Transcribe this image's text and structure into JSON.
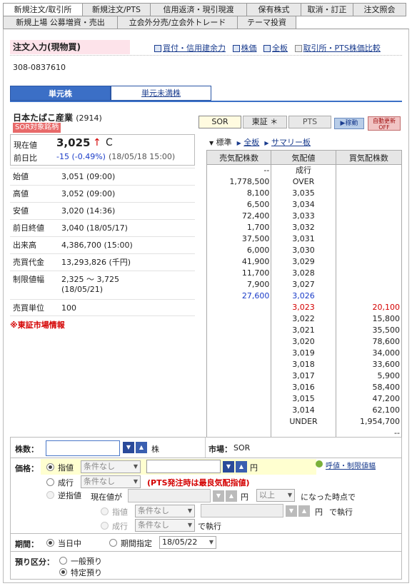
{
  "tabs_row1": [
    "新規注文/取引所",
    "新規注文/PTS",
    "信用返済・現引現渡",
    "保有株式",
    "取消・訂正",
    "注文照会"
  ],
  "tabs_row2": [
    "新規上場 公募増資・売出",
    "立会外分売/立会外トレード",
    "テーマ投資"
  ],
  "title": "注文入力(現物買)",
  "links": [
    "買付・信用建余力",
    "株価",
    "全板",
    "取引所・PTS株価比較"
  ],
  "account": "308-0837610",
  "unit_tabs": [
    "単元株",
    "単元未満株"
  ],
  "stock": {
    "name": "日本たばこ産業",
    "code": "(2914)",
    "sor_badge": "SOR対象銘柄"
  },
  "market_buttons": [
    "SOR",
    "東証 ＊",
    "PTS"
  ],
  "mini_buttons": [
    "▶稼動",
    "自動更新OFF"
  ],
  "price_box": {
    "label_now": "現在値",
    "now": "3,025",
    "arrow": "↑",
    "flag": "C",
    "label_chg": "前日比",
    "chg": "-15 (-0.49%)",
    "chg_time": "(18/05/18 15:00)"
  },
  "details": [
    {
      "k": "始値",
      "v": "3,051 (09:00)"
    },
    {
      "k": "高値",
      "v": "3,052 (09:00)"
    },
    {
      "k": "安値",
      "v": "3,020 (14:36)"
    },
    {
      "k": "前日終値",
      "v": "3,040 (18/05/17)"
    },
    {
      "k": "出来高",
      "v": "4,386,700 (15:00)"
    },
    {
      "k": "売買代金",
      "v": "13,293,826 (千円)"
    },
    {
      "k": "制限値幅",
      "v": "2,325 〜 3,725",
      "v2": "(18/05/21)"
    },
    {
      "k": "売買単位",
      "v": "100"
    }
  ],
  "tse_info": "※東証市場情報",
  "board_links": [
    "標準",
    "全板",
    "サマリー板"
  ],
  "board_headers": [
    "売気配株数",
    "気配値",
    "買気配株数"
  ],
  "board_rows": [
    [
      "--",
      "成行",
      ""
    ],
    [
      "1,778,500",
      "OVER",
      ""
    ],
    [
      "8,100",
      "3,035",
      ""
    ],
    [
      "6,500",
      "3,034",
      ""
    ],
    [
      "72,400",
      "3,033",
      ""
    ],
    [
      "1,700",
      "3,032",
      ""
    ],
    [
      "37,500",
      "3,031",
      ""
    ],
    [
      "6,000",
      "3,030",
      ""
    ],
    [
      "41,900",
      "3,029",
      ""
    ],
    [
      "11,700",
      "3,028",
      ""
    ],
    [
      "7,900",
      "3,027",
      ""
    ],
    [
      "27,600",
      "3,026",
      ""
    ],
    [
      "",
      "3,023",
      "20,100"
    ],
    [
      "",
      "3,022",
      "15,800"
    ],
    [
      "",
      "3,021",
      "35,500"
    ],
    [
      "",
      "3,020",
      "78,600"
    ],
    [
      "",
      "3,019",
      "34,000"
    ],
    [
      "",
      "3,018",
      "33,600"
    ],
    [
      "",
      "3,017",
      "5,900"
    ],
    [
      "",
      "3,016",
      "58,400"
    ],
    [
      "",
      "3,015",
      "47,200"
    ],
    [
      "",
      "3,014",
      "62,100"
    ],
    [
      "",
      "UNDER",
      "1,954,700"
    ],
    [
      "",
      "",
      "--"
    ]
  ],
  "colors": {
    "accent": "#1a3c8e",
    "red": "#d40000",
    "blue": "#1a3cc8",
    "yellow": "#ffffd0"
  },
  "form": {
    "qty_label": "株数：",
    "qty_unit": "株",
    "market_label": "市場：",
    "market_value": "SOR",
    "price_label": "価格：",
    "limit": "指値",
    "cond_none": "条件なし",
    "yen": "円",
    "help_link": "呼値・制限値幅",
    "market_order": "成行",
    "pts_note": "(PTS発注時は最良気配指値)",
    "stop": "逆指値",
    "stop_current": "現在値が",
    "stop_above": "以上",
    "stop_when": "になった時点で",
    "stop_limit": "指値",
    "stop_exec": "で執行",
    "stop_market": "成行",
    "period_label": "期間：",
    "today": "当日中",
    "period_spec": "期間指定",
    "period_date": "18/05/22",
    "deposit_label": "預り区分：",
    "general": "一般預り",
    "special": "特定預り"
  }
}
